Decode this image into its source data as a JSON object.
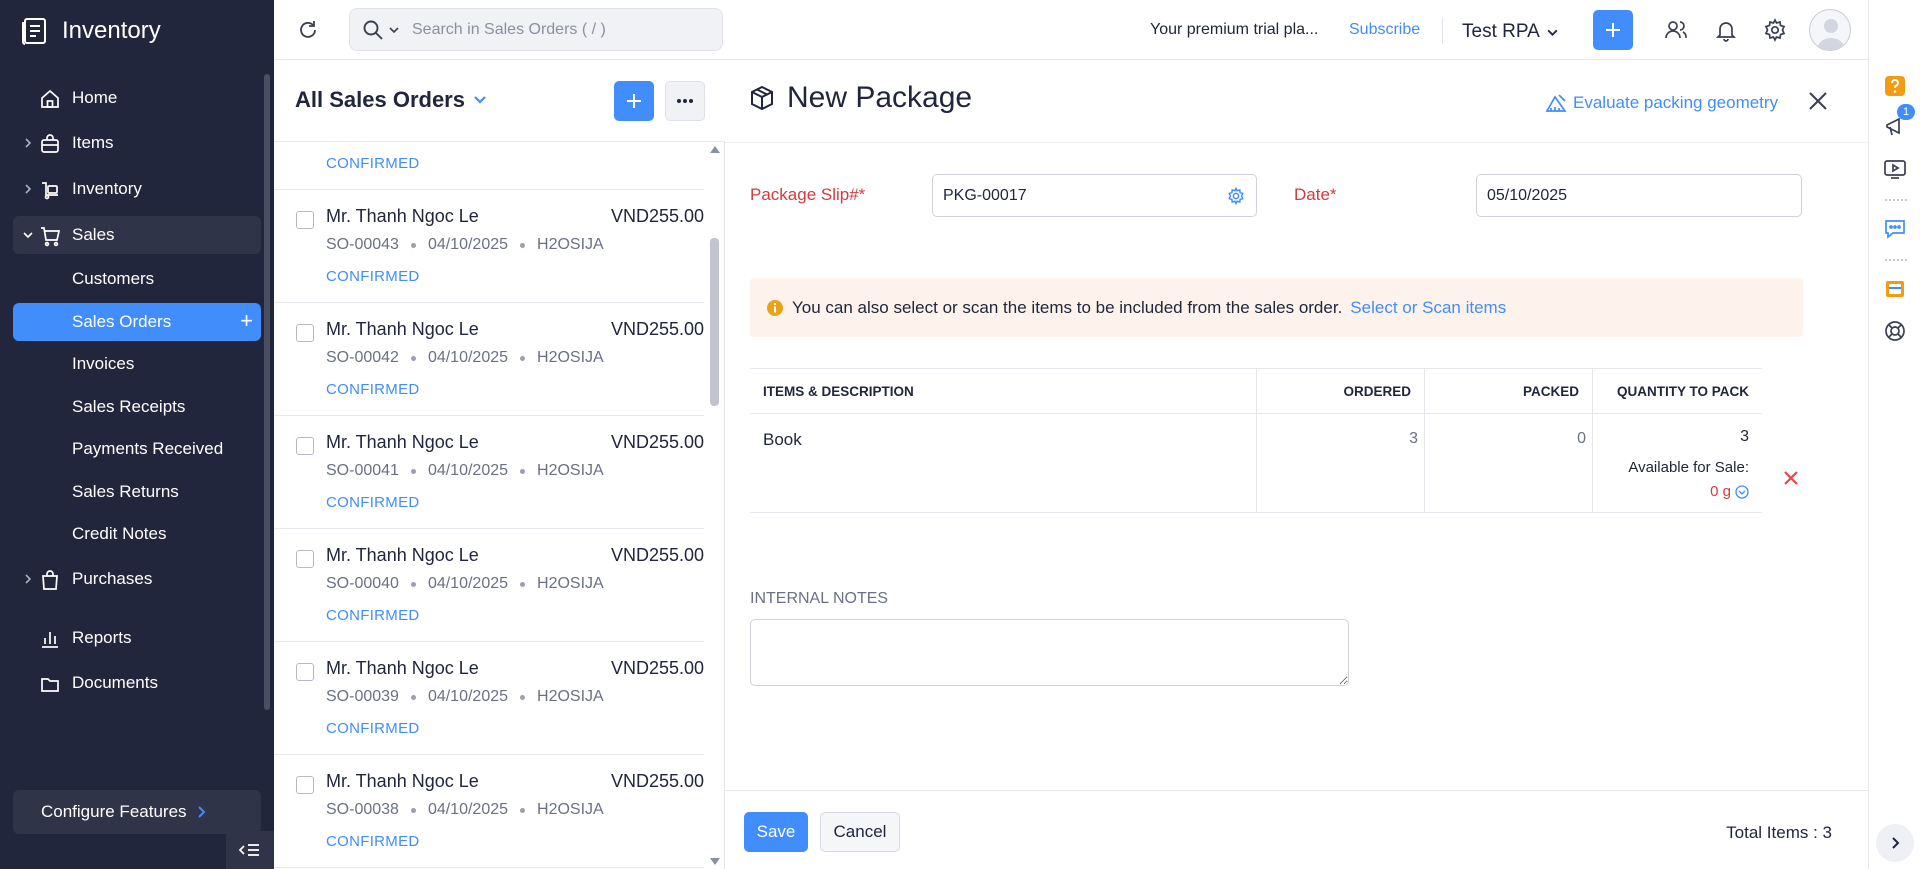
{
  "app": {
    "name": "Inventory"
  },
  "sidebar": {
    "items": [
      {
        "label": "Home",
        "icon": "home-icon"
      },
      {
        "label": "Items",
        "icon": "bag-icon"
      },
      {
        "label": "Inventory",
        "icon": "box-icon"
      },
      {
        "label": "Sales",
        "icon": "cart-icon"
      },
      {
        "label": "Purchases",
        "icon": "shopping-bag-icon"
      },
      {
        "label": "Reports",
        "icon": "bar-chart-icon"
      },
      {
        "label": "Documents",
        "icon": "folder-icon"
      }
    ],
    "sales_sub": [
      "Customers",
      "Sales Orders",
      "Invoices",
      "Sales Receipts",
      "Payments Received",
      "Sales Returns",
      "Credit Notes"
    ],
    "configure": "Configure Features"
  },
  "topbar": {
    "search_placeholder": "Search in Sales Orders ( / )",
    "trial_text": "Your premium trial pla...",
    "subscribe": "Subscribe",
    "org": "Test RPA"
  },
  "list": {
    "title": "All Sales Orders",
    "partial_status": "CONFIRMED",
    "rows": [
      {
        "name": "Mr. Thanh Ngoc Le",
        "amount": "VND255.00",
        "so": "SO-00043",
        "date": "04/10/2025",
        "ref": "H2OSIJA",
        "status": "CONFIRMED"
      },
      {
        "name": "Mr. Thanh Ngoc Le",
        "amount": "VND255.00",
        "so": "SO-00042",
        "date": "04/10/2025",
        "ref": "H2OSIJA",
        "status": "CONFIRMED"
      },
      {
        "name": "Mr. Thanh Ngoc Le",
        "amount": "VND255.00",
        "so": "SO-00041",
        "date": "04/10/2025",
        "ref": "H2OSIJA",
        "status": "CONFIRMED"
      },
      {
        "name": "Mr. Thanh Ngoc Le",
        "amount": "VND255.00",
        "so": "SO-00040",
        "date": "04/10/2025",
        "ref": "H2OSIJA",
        "status": "CONFIRMED"
      },
      {
        "name": "Mr. Thanh Ngoc Le",
        "amount": "VND255.00",
        "so": "SO-00039",
        "date": "04/10/2025",
        "ref": "H2OSIJA",
        "status": "CONFIRMED"
      },
      {
        "name": "Mr. Thanh Ngoc Le",
        "amount": "VND255.00",
        "so": "SO-00038",
        "date": "04/10/2025",
        "ref": "H2OSIJA",
        "status": "CONFIRMED"
      }
    ]
  },
  "package": {
    "title": "New Package",
    "evaluate": "Evaluate packing geometry",
    "slip_label": "Package Slip#*",
    "slip_value": "PKG-00017",
    "date_label": "Date*",
    "date_value": "05/10/2025",
    "info_text": "You can also select or scan the items to be included from the sales order.",
    "info_link": "Select or Scan items",
    "table": {
      "headers": [
        "ITEMS & DESCRIPTION",
        "ORDERED",
        "PACKED",
        "QUANTITY TO PACK"
      ],
      "item": "Book",
      "ordered": "3",
      "packed": "0",
      "qty": "3",
      "available_label": "Available for Sale:",
      "available_value": "0 g"
    },
    "notes_label": "INTERNAL NOTES",
    "save": "Save",
    "cancel": "Cancel",
    "total": "Total Items : 3"
  },
  "rightrail": {
    "badge": "1"
  },
  "colors": {
    "sidebar": "#21263c",
    "accent": "#408dfb",
    "required": "#d6393e",
    "danger": "#e5484d",
    "info_bg": "#fdf3ec"
  }
}
